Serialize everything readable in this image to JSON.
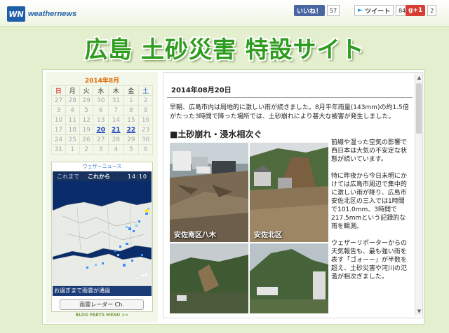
{
  "brand": {
    "logo_mark": "WN",
    "logo_text": "weathernews"
  },
  "social": {
    "facebook": {
      "label": "いいね！",
      "count": "57"
    },
    "twitter": {
      "label": "ツイート",
      "count": "84"
    },
    "gplus": {
      "label": "g+1",
      "count": "2"
    }
  },
  "page_title": "広島 土砂災害 特設サイト",
  "calendar": {
    "title": "2014年8月",
    "weekdays": [
      "日",
      "月",
      "火",
      "水",
      "木",
      "金",
      "土"
    ],
    "weeks": [
      [
        "27",
        "28",
        "29",
        "30",
        "31",
        "1",
        "2"
      ],
      [
        "3",
        "4",
        "5",
        "6",
        "7",
        "8",
        "9"
      ],
      [
        "10",
        "11",
        "12",
        "13",
        "14",
        "15",
        "16"
      ],
      [
        "17",
        "18",
        "19",
        "20",
        "21",
        "22",
        "23"
      ],
      [
        "24",
        "25",
        "26",
        "27",
        "28",
        "29",
        "30"
      ],
      [
        "31",
        "1",
        "2",
        "3",
        "4",
        "5",
        "6"
      ]
    ],
    "links": [
      "20",
      "21",
      "22"
    ]
  },
  "radar": {
    "header": "ウェザーニュース",
    "tab_past": "これまで",
    "tab_future": "これから",
    "time": "14:10",
    "status": "お過ぎまで雨雲が通過",
    "button": "雨雲レーダー Ch.",
    "blog_link": "BLOG PARTS MENU  >>"
  },
  "article": {
    "date": "2014年08月20日",
    "intro": "早朝、広島市内は局地的に激しい雨が続きました。8月平年雨量(143mm)の約1.5倍がたった3時間で降った場所では、土砂崩れにより甚大な被害が発生しました。",
    "heading": "■土砂崩れ・浸水相次ぐ",
    "photos": [
      {
        "caption": "安佐南区八木"
      },
      {
        "caption": "安佐北区"
      },
      {
        "caption": ""
      },
      {
        "caption": ""
      }
    ],
    "paragraphs": [
      "前線や湿った空気の影響で西日本は大気の不安定な状態が続いています。",
      "特に昨夜から今日未明にかけては広島市周辺で集中的に激しい雨が降り、広島市安佐北区の三入では1時間で101.0mm、3時間で217.5mmという記録的な雨を観測。",
      "ウェザーリポーターからの天気報告も、最も強い雨を表す「ゴォーー」が半数を超え、土砂災害や河川の氾濫が相次ぎました。"
    ]
  },
  "colors": {
    "title_green": "#2e9c1c",
    "radar_navy": "#18325e",
    "fb_blue": "#4a66a0",
    "gplus_red": "#d73d32"
  }
}
